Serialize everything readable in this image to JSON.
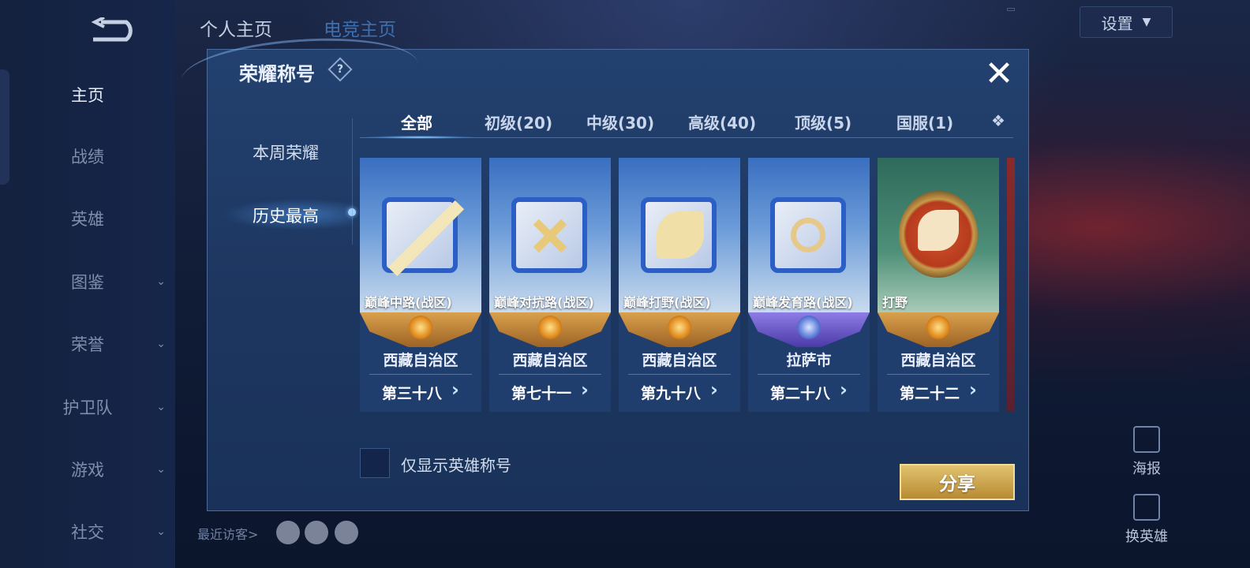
{
  "profile_tabs": [
    "个人主页",
    "电竞主页"
  ],
  "settings_label": "设置",
  "sidebar": {
    "items": [
      {
        "label": "主页"
      },
      {
        "label": "战绩"
      },
      {
        "label": "英雄"
      },
      {
        "label": "图鉴"
      },
      {
        "label": "荣誉"
      },
      {
        "label": "护卫队"
      },
      {
        "label": "游戏"
      },
      {
        "label": "社交"
      }
    ]
  },
  "visitors_label": "最近访客>",
  "right_buttons": {
    "poster": "海报",
    "change_hero": "换英雄"
  },
  "modal": {
    "title": "荣耀称号",
    "help": "?",
    "close": "✕",
    "subnav": [
      "本周荣耀",
      "历史最高"
    ],
    "subnav_active": 1,
    "tabs": [
      "全部",
      "初级(20)",
      "中级(30)",
      "高级(40)",
      "顶级(5)",
      "国服(1)"
    ],
    "tab_more": "❖",
    "cards": [
      {
        "name": "巅峰中路(战区)",
        "region": "西藏自治区",
        "place": "第三十八",
        "rank_tier": "gold"
      },
      {
        "name": "巅峰对抗路(战区)",
        "region": "西藏自治区",
        "place": "第七十一",
        "rank_tier": "gold"
      },
      {
        "name": "巅峰打野(战区)",
        "region": "西藏自治区",
        "place": "第九十八",
        "rank_tier": "gold"
      },
      {
        "name": "巅峰发育路(战区)",
        "region": "拉萨市",
        "place": "第二十八",
        "rank_tier": "purple"
      },
      {
        "name": "打野",
        "region": "西藏自治区",
        "place": "第二十二",
        "rank_tier": "gold"
      }
    ],
    "checkbox_label": "仅显示英雄称号",
    "share_label": "分享"
  },
  "colors": {
    "accent_gold": "#d9a14d",
    "panel_blue": "#1d3761"
  }
}
